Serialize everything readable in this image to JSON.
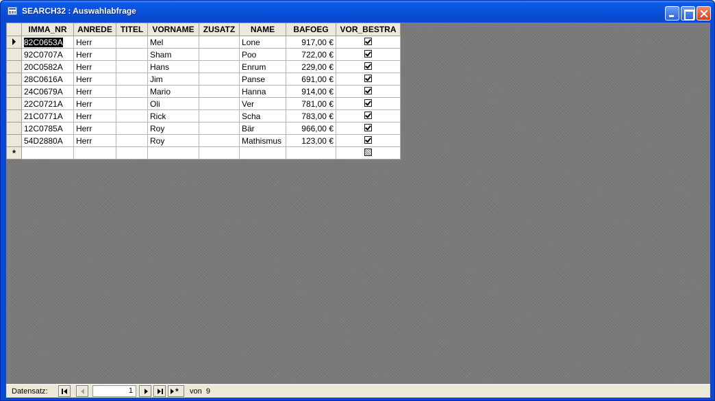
{
  "window": {
    "title": "SEARCH32 : Auswahlabfrage"
  },
  "grid": {
    "columns": [
      "IMMA_NR",
      "ANREDE",
      "TITEL",
      "VORNAME",
      "ZUSATZ",
      "NAME",
      "BAFOEG",
      "VOR_BESTRA"
    ],
    "rows": [
      {
        "imma_nr": "82C0653A",
        "anrede": "Herr",
        "titel": "",
        "vorname": "Mel",
        "zusatz": "",
        "name": "Lone",
        "bafoeg": "917,00 €",
        "vor_bestra": true
      },
      {
        "imma_nr": "92C0707A",
        "anrede": "Herr",
        "titel": "",
        "vorname": "Sham",
        "zusatz": "",
        "name": "Poo",
        "bafoeg": "722,00 €",
        "vor_bestra": true
      },
      {
        "imma_nr": "20C0582A",
        "anrede": "Herr",
        "titel": "",
        "vorname": "Hans",
        "zusatz": "",
        "name": "Enrum",
        "bafoeg": "229,00 €",
        "vor_bestra": true
      },
      {
        "imma_nr": "28C0616A",
        "anrede": "Herr",
        "titel": "",
        "vorname": "Jim",
        "zusatz": "",
        "name": "Panse",
        "bafoeg": "691,00 €",
        "vor_bestra": true
      },
      {
        "imma_nr": "24C0679A",
        "anrede": "Herr",
        "titel": "",
        "vorname": "Mario",
        "zusatz": "",
        "name": "Hanna",
        "bafoeg": "914,00 €",
        "vor_bestra": true
      },
      {
        "imma_nr": "22C0721A",
        "anrede": "Herr",
        "titel": "",
        "vorname": "Oli",
        "zusatz": "",
        "name": "Ver",
        "bafoeg": "781,00 €",
        "vor_bestra": true
      },
      {
        "imma_nr": "21C0771A",
        "anrede": "Herr",
        "titel": "",
        "vorname": "Rick",
        "zusatz": "",
        "name": "Scha",
        "bafoeg": "783,00 €",
        "vor_bestra": true
      },
      {
        "imma_nr": "12C0785A",
        "anrede": "Herr",
        "titel": "",
        "vorname": "Roy",
        "zusatz": "",
        "name": "Bär",
        "bafoeg": "966,00 €",
        "vor_bestra": true
      },
      {
        "imma_nr": "54D2880A",
        "anrede": "Herr",
        "titel": "",
        "vorname": "Roy",
        "zusatz": "",
        "name": "Mathismus",
        "bafoeg": "123,00 €",
        "vor_bestra": true
      }
    ],
    "new_row_marker": "*"
  },
  "navigation": {
    "label": "Datensatz:",
    "current": "1",
    "of_label": "von",
    "total": "9"
  }
}
